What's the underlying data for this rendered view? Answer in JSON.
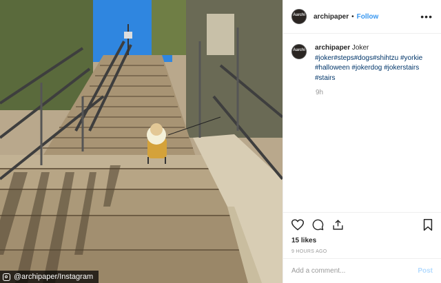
{
  "photo": {
    "credit_text": "@archipaper/Instagram",
    "credit_icon": "instagram-icon"
  },
  "header": {
    "avatar_text": "Aarchi",
    "username": "archipaper",
    "separator": "•",
    "follow_label": "Follow",
    "more_label": "•••"
  },
  "caption": {
    "username": "archipaper",
    "text": "Joker",
    "hashtags": [
      "#joker",
      "#steps",
      "#dogs",
      "#shihtzu",
      "#yorkie",
      "#halloween",
      "#jokerdog",
      "#jokerstairs",
      "#stairs"
    ],
    "time": "9h"
  },
  "actions": {
    "icons": [
      "heart-icon",
      "comment-icon",
      "share-icon",
      "bookmark-icon"
    ],
    "likes": "15 likes",
    "posted_ago": "9 HOURS AGO"
  },
  "comment_box": {
    "placeholder": "Add a comment...",
    "post_label": "Post"
  },
  "colors": {
    "link": "#3897f0",
    "hashtag": "#003569",
    "sky": "#2f86e0",
    "stone": "#b9a88c"
  }
}
